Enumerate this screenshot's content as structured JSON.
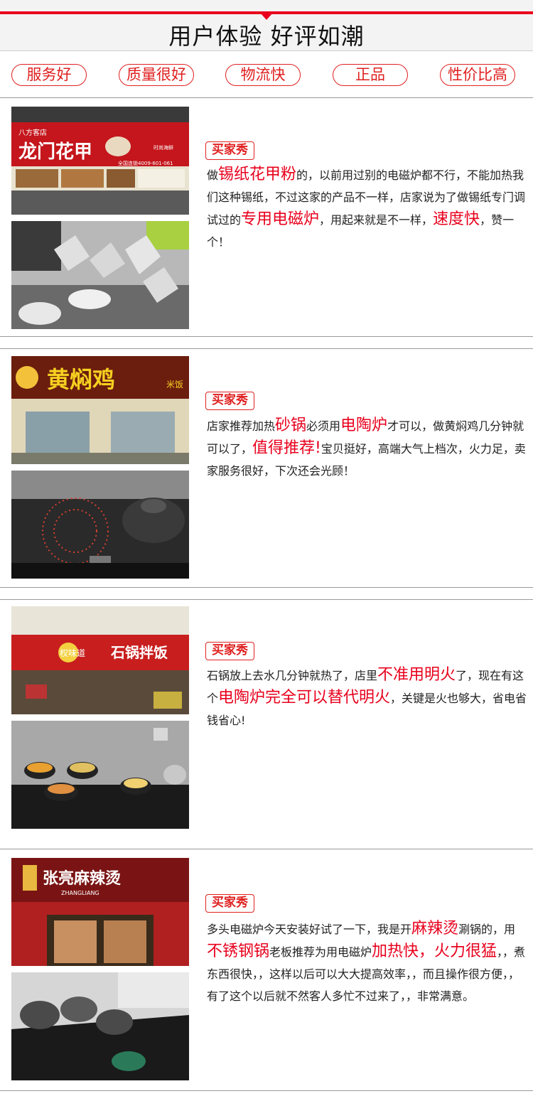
{
  "header": {
    "title": "用户体验 好评如潮"
  },
  "tags": [
    "服务好",
    "质量很好",
    "物流快",
    "正品",
    "性价比高"
  ],
  "badge_label": "买家秀",
  "colors": {
    "accent": "#e8001c"
  },
  "reviews": [
    {
      "photo1_sign": {
        "small": "八方客店",
        "big": "龙门花甲",
        "sub": "时尚海鲜",
        "phone": "全国连锁4009-601-061"
      },
      "text": [
        {
          "t": "做",
          "h": false
        },
        {
          "t": "锡纸花甲粉",
          "h": true
        },
        {
          "t": "的，以前用过别的电磁炉都不行，不能加热我们这种锡纸，不过这家的产品不一样，店家说为了做锡纸专门调试过的",
          "h": false
        },
        {
          "t": "专用电磁炉",
          "h": true
        },
        {
          "t": "，用起来就是不一样，",
          "h": false
        },
        {
          "t": "速度快",
          "h": true
        },
        {
          "t": "，赞一个！",
          "h": false
        }
      ]
    },
    {
      "photo1_sign": {
        "big": "黄焖鸡",
        "sub": "米饭"
      },
      "text": [
        {
          "t": "店家推荐加热",
          "h": false
        },
        {
          "t": "砂锅",
          "h": true
        },
        {
          "t": "必须用",
          "h": false
        },
        {
          "t": "电陶炉",
          "h": true
        },
        {
          "t": "才可以，做黄焖鸡几分钟就可以了，",
          "h": false
        },
        {
          "t": "值得推荐!",
          "h": true
        },
        {
          "t": "宝贝挺好，高端大气上档次，火力足，卖家服务很好，下次还会光顾！",
          "h": false
        }
      ]
    },
    {
      "photo1_sign": {
        "big": "石锅拌饭",
        "sub": "权味道"
      },
      "text": [
        {
          "t": "石锅放上去水几分钟就热了，店里",
          "h": false
        },
        {
          "t": "不准用明火",
          "h": true
        },
        {
          "t": "了，现在有这个",
          "h": false
        },
        {
          "t": "电陶炉完全可以替代明火",
          "h": true
        },
        {
          "t": "，关键是火也够大，省电省钱省心!",
          "h": false
        }
      ]
    },
    {
      "photo1_sign": {
        "big": "张亮麻辣烫",
        "sub": "ZHANGLIANG"
      },
      "text": [
        {
          "t": "多头电磁炉今天安装好试了一下，我是开",
          "h": false
        },
        {
          "t": "麻辣烫",
          "h": true
        },
        {
          "t": "涮锅的，用",
          "h": false
        },
        {
          "t": "不锈钢锅",
          "h": true
        },
        {
          "t": "老板推荐为用电磁炉",
          "h": false
        },
        {
          "t": "加热快，火力很猛",
          "h": true
        },
        {
          "t": "，，煮东西很快，，这样以后可以大大提高效率，，而且操作很方便，，有了这个以后就不然客人多忙不过来了，，非常满意。",
          "h": false
        }
      ]
    }
  ]
}
